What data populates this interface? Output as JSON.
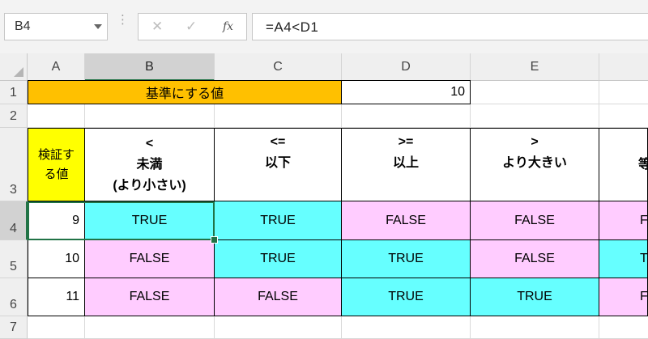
{
  "name_box": "B4",
  "formula": "=A4<D1",
  "formula_buttons": {
    "cancel": "✕",
    "enter": "✓",
    "fx": "fx"
  },
  "columns": [
    "A",
    "B",
    "C",
    "D",
    "E"
  ],
  "rows": [
    "1",
    "2",
    "3",
    "4",
    "5",
    "6",
    "7"
  ],
  "row1": {
    "label": "基準にする値",
    "value": "10"
  },
  "row3": {
    "a": [
      "検証す",
      "る値"
    ],
    "b": [
      "<",
      "未満",
      "(より小さい)"
    ],
    "c": [
      "<=",
      "以下"
    ],
    "d": [
      ">=",
      "以上"
    ],
    "e": [
      ">",
      "より大きい"
    ],
    "f": "等"
  },
  "data_rows": [
    {
      "a": "9",
      "b": "TRUE",
      "c": "TRUE",
      "d": "FALSE",
      "e": "FALSE",
      "f": "F"
    },
    {
      "a": "10",
      "b": "FALSE",
      "c": "TRUE",
      "d": "TRUE",
      "e": "FALSE",
      "f": "T"
    },
    {
      "a": "11",
      "b": "FALSE",
      "c": "FALSE",
      "d": "TRUE",
      "e": "TRUE",
      "f": "F"
    }
  ],
  "colors": {
    "selection": "#217346",
    "orange": "#ffc000",
    "yellow": "#ffff00",
    "true_fill": "#66ffff",
    "false_fill": "#ffccff"
  }
}
